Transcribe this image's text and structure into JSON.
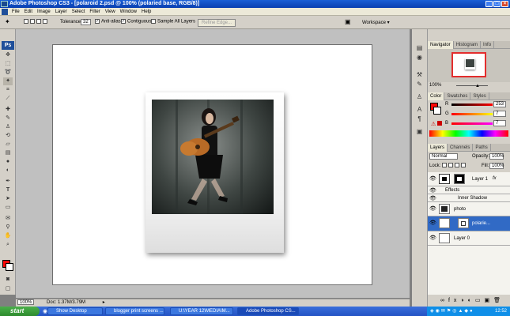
{
  "window": {
    "title": "Adobe Photoshop CS3 - [polaroid 2.psd @ 100% (polaried base, RGB/8)]"
  },
  "menu": {
    "items": [
      "File",
      "Edit",
      "Image",
      "Layer",
      "Select",
      "Filter",
      "View",
      "Window",
      "Help"
    ]
  },
  "options": {
    "tolerance_label": "Tolerance:",
    "tolerance_value": "32",
    "anti_alias_label": "Anti-alias",
    "contiguous_label": "Contiguous",
    "sample_all_label": "Sample All Layers",
    "refine_edge_label": "Refine Edge...",
    "workspace_label": "Workspace"
  },
  "status": {
    "zoom": "100%",
    "doc_info": "Doc: 1.37M/3.79M"
  },
  "navigator": {
    "tabs": [
      "Navigator",
      "Histogram",
      "Info"
    ],
    "zoom": "100%"
  },
  "color": {
    "tabs": [
      "Color",
      "Swatches",
      "Styles"
    ],
    "r_label": "R",
    "g_label": "G",
    "b_label": "B",
    "r_value": "253",
    "g_value": "7",
    "b_value": "7",
    "fg_color": "#fd0707"
  },
  "layers": {
    "tabs": [
      "Layers",
      "Channels",
      "Paths"
    ],
    "blend_mode": "Normal",
    "opacity_label": "Opacity:",
    "opacity_value": "100%",
    "lock_label": "Lock:",
    "fill_label": "Fill:",
    "fill_value": "100%",
    "rows": [
      {
        "name": "Layer 1",
        "fx": "fx"
      },
      {
        "name": "Effects"
      },
      {
        "name": "Inner Shadow"
      },
      {
        "name": "photo"
      },
      {
        "name": "polarie...",
        "selected": true
      },
      {
        "name": "Layer 0"
      }
    ]
  },
  "taskbar": {
    "start_label": "start",
    "buttons": [
      "Show Desktop",
      "blogger print screens ...",
      "U:\\YEAR 12\\MEDIA\\M...",
      "Adobe Photoshop CS..."
    ],
    "clock": "12:52"
  },
  "colors": {
    "accent_blue": "#316ac5",
    "foreground_red": "#fd0707",
    "taskbar_blue": "#245edb"
  }
}
